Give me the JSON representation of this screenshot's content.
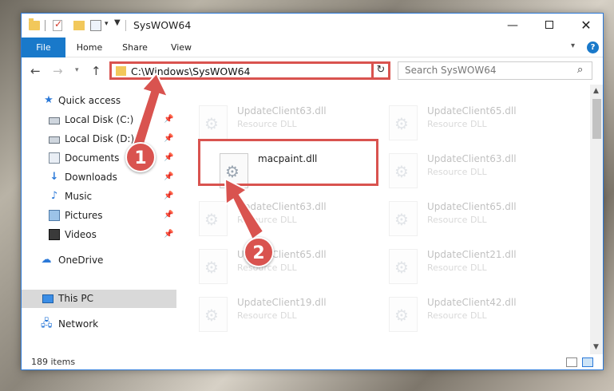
{
  "window": {
    "title": "SysWOW64",
    "controls": {
      "minimize": "—",
      "maximize": "",
      "close": "✕"
    }
  },
  "ribbon": {
    "tabs": [
      "File",
      "Home",
      "Share",
      "View"
    ],
    "help": "?"
  },
  "navigation": {
    "address": "C:\\Windows\\SysWOW64",
    "search_placeholder": "Search SysWOW64"
  },
  "sidebar": {
    "items": [
      {
        "label": "Quick access",
        "icon": "star-icon"
      },
      {
        "label": "Local Disk (C:)",
        "icon": "disk-icon",
        "pinned": true
      },
      {
        "label": "Local Disk (D:)",
        "icon": "disk-icon",
        "pinned": true
      },
      {
        "label": "Documents",
        "icon": "documents-icon",
        "pinned": true
      },
      {
        "label": "Downloads",
        "icon": "download-icon",
        "pinned": true
      },
      {
        "label": "Music",
        "icon": "music-icon",
        "pinned": true
      },
      {
        "label": "Pictures",
        "icon": "pictures-icon",
        "pinned": true
      },
      {
        "label": "Videos",
        "icon": "videos-icon",
        "pinned": true
      },
      {
        "label": "OneDrive",
        "icon": "cloud-icon"
      },
      {
        "label": "This PC",
        "icon": "computer-icon",
        "selected": true
      },
      {
        "label": "Network",
        "icon": "network-icon"
      }
    ]
  },
  "files": {
    "highlighted": {
      "name": "macpaint.dll",
      "type": ""
    },
    "tiles": [
      {
        "name": "UpdateClient63.dll",
        "type": "Resource DLL"
      },
      {
        "name": "UpdateClient65.dll",
        "type": "Resource DLL"
      },
      {
        "name": "UpdateClient63.dll",
        "type": "Resource DLL"
      },
      {
        "name": "UpdateClient63.dll",
        "type": "Resource DLL"
      },
      {
        "name": "UpdateClient65.dll",
        "type": "Resource DLL"
      },
      {
        "name": "UpdateClient65.dll",
        "type": "Resource DLL"
      },
      {
        "name": "UpdateClient21.dll",
        "type": "Resource DLL"
      },
      {
        "name": "UpdateClient19.dll",
        "type": "Resource DLL"
      },
      {
        "name": "UpdateClient42.dll",
        "type": "Resource DLL"
      }
    ]
  },
  "status": {
    "item_count": "189 items"
  },
  "callouts": [
    "1",
    "2"
  ],
  "colors": {
    "accent": "#1979ca",
    "callout": "#d9534f",
    "selection": "#d9d9d9"
  }
}
